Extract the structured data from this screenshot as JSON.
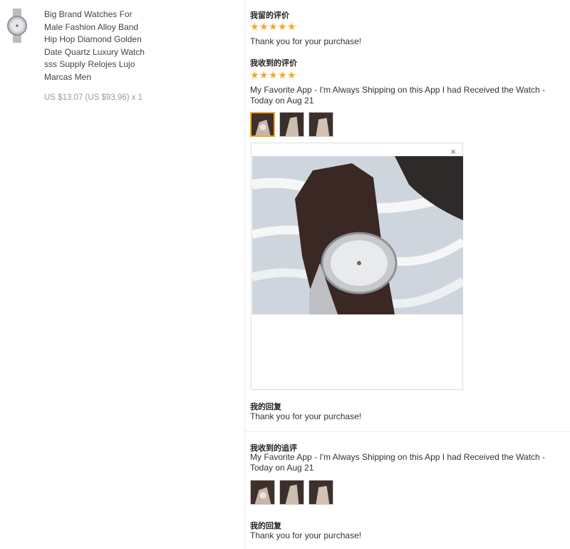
{
  "product": {
    "title_lines": [
      "Big Brand Watches For",
      "Male Fashion Alloy Band",
      "Hip Hop Diamond Golden",
      "Date Quartz Luxury Watch",
      "sss Supply Relojes Lujo",
      "Marcas Men"
    ],
    "price": "US $13.07 (US $93.96) x 1",
    "thumb_icon": "watch-icon"
  },
  "my_review": {
    "title": "我留的评价",
    "rating": 5,
    "text": "Thank you for your purchase!"
  },
  "received_review": {
    "title": "我收到的评价",
    "rating": 5,
    "text_lines": [
      "My Favorite App - I'm Always Shipping on this App I had Received the Watch -",
      "Today on Aug 21"
    ],
    "thumb_count": 3,
    "close_symbol": "×"
  },
  "my_reply": {
    "title": "我的回复",
    "text": "Thank you for your purchase!"
  },
  "followup_review": {
    "title": "我收到的追评",
    "text_lines": [
      "My Favorite App - I'm Always Shipping on this App I had Received the Watch -",
      "Today on Aug 21"
    ],
    "thumb_count": 3
  },
  "followup_reply": {
    "title": "我的回复",
    "text": "Thank you for your purchase!"
  },
  "colors": {
    "star": "#f6a623",
    "text": "#333333",
    "muted": "#999999"
  }
}
